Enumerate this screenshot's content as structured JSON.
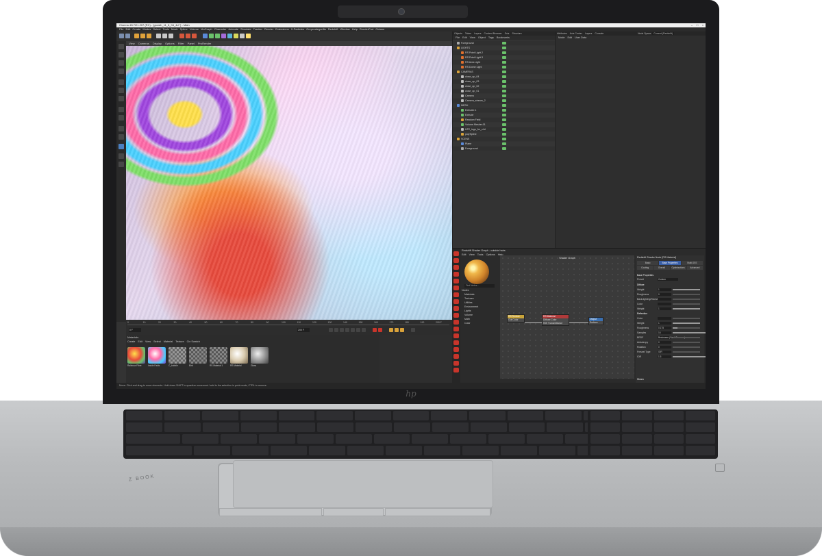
{
  "app": {
    "title": "Cinema 4D R21.207 (RC) - [growth_11_8_04_4d *] - Main",
    "node_space_label": "Node Space:",
    "node_space_value": "Current (Redshift)",
    "layout_label": "Layout:",
    "layout_value": "Startup (User)"
  },
  "menubar": [
    "File",
    "Edit",
    "Create",
    "Modes",
    "Select",
    "Tools",
    "Mesh",
    "Spline",
    "Volume",
    "MoGraph",
    "Character",
    "Animate",
    "Simulate",
    "Tracker",
    "Render",
    "Extensions",
    "X-Particles",
    "Greyscalegorilla",
    "Redshift",
    "Window",
    "Help",
    "RenderPort",
    "Octane"
  ],
  "viewport": {
    "menu": [
      "View",
      "Cameras",
      "Display",
      "Options",
      "Filter",
      "Panel",
      "ProRender"
    ],
    "timeline_ticks": [
      "0",
      "10",
      "20",
      "30",
      "40",
      "50",
      "60",
      "70",
      "80",
      "90",
      "100",
      "110",
      "120",
      "130",
      "140",
      "150",
      "160",
      "170",
      "180",
      "190",
      "200 F"
    ],
    "current_frame": "0 F",
    "end_frame": "200 F"
  },
  "materials": {
    "title": "Materials",
    "menu": [
      "Create",
      "Edit",
      "View",
      "Select",
      "Material",
      "Texture",
      "Cin Swatch"
    ],
    "items": [
      "Rainbow Fibre",
      "Inside Fadis",
      "C_bubble",
      "Bird",
      "RS Material 1",
      "RS Material",
      "Glass"
    ]
  },
  "object_manager": {
    "tabs": [
      "Objects",
      "Takes",
      "Layers",
      "Content Browser",
      "Scts",
      "Structure"
    ],
    "menu": [
      "File",
      "Edit",
      "View",
      "Object",
      "Tags",
      "Bookmarks"
    ],
    "rows": [
      {
        "name": "Foreground",
        "color": "#aaaaaa",
        "indent": 0
      },
      {
        "name": "LIGHTS",
        "color": "#d9a23a",
        "indent": 0
      },
      {
        "name": "RS Point Light.2",
        "color": "#e0702d",
        "indent": 1
      },
      {
        "name": "RS Point Light.3",
        "color": "#e0702d",
        "indent": 1
      },
      {
        "name": "RS Area Light",
        "color": "#e0702d",
        "indent": 1
      },
      {
        "name": "RS Dome Light",
        "color": "#e0702d",
        "indent": 1
      },
      {
        "name": "CAMERAS",
        "color": "#d9a23a",
        "indent": 0
      },
      {
        "name": "close_up_04",
        "color": "#bbbbbb",
        "indent": 1
      },
      {
        "name": "close_up_03",
        "color": "#bbbbbb",
        "indent": 1
      },
      {
        "name": "close_up_02",
        "color": "#bbbbbb",
        "indent": 1
      },
      {
        "name": "close_up_01",
        "color": "#bbbbbb",
        "indent": 1
      },
      {
        "name": "Camera",
        "color": "#bbbbbb",
        "indent": 1
      },
      {
        "name": "Camera_stream_2",
        "color": "#bbbbbb",
        "indent": 1
      },
      {
        "name": "MESH",
        "color": "#5a8ad9",
        "indent": 0
      },
      {
        "name": "Extruder.1",
        "color": "#6bc26b",
        "indent": 1
      },
      {
        "name": "Extrude",
        "color": "#6bc26b",
        "indent": 1
      },
      {
        "name": "Random Field",
        "color": "#d9a23a",
        "indent": 1
      },
      {
        "name": "Volume Mesher.01",
        "color": "#6bc26b",
        "indent": 1
      },
      {
        "name": "HP2_logo_for_c4d",
        "color": "#bbbbbb",
        "indent": 1
      },
      {
        "name": "polySpline",
        "color": "#d9a23a",
        "indent": 1
      },
      {
        "name": "SCENE",
        "color": "#d9a23a",
        "indent": 0
      },
      {
        "name": "Plane",
        "color": "#5a8ad9",
        "indent": 1
      },
      {
        "name": "Foreground",
        "color": "#aaaaaa",
        "indent": 1
      }
    ]
  },
  "attribute_manager": {
    "tabs": [
      "Attributes",
      "Axis Center",
      "Layers",
      "Console"
    ],
    "menu": [
      "Mode",
      "Edit",
      "User Data"
    ]
  },
  "shader_graph": {
    "title": "Redshift Shader Graph - outside hairs",
    "menu": [
      "Edit",
      "View",
      "Tools",
      "Options",
      "Help"
    ],
    "graph_title": "Shader Graph",
    "find_placeholder": "Find Nodes...",
    "categories": [
      "Nodes",
      "Materials",
      "Textures",
      "Utilities",
      "Environment",
      "Lights",
      "Volume",
      "Math",
      "Color"
    ],
    "nodes": {
      "rs_texture": {
        "title": "RS Texture",
        "ports": [
          "Out Color"
        ]
      },
      "rs_material": {
        "title": "RS Material",
        "ports": [
          "Diffuse Color",
          "Refl Transmittance",
          "Out Color"
        ]
      },
      "output": {
        "title": "Output",
        "ports": [
          "Surface"
        ]
      }
    },
    "properties": {
      "title": "Redshift Shader Node [RS Material]",
      "tabs": [
        "Basic",
        "Base Properties",
        "Multi-SSS",
        "Coating",
        "Overall",
        "Optimizations",
        "Advanced"
      ],
      "section_base": "Base Properties",
      "preset_label": "Preset",
      "preset_value": "Custom",
      "diffuse": "Diffuse",
      "rows": [
        {
          "label": "Weight",
          "value": "1"
        },
        {
          "label": "Roughness",
          "value": "0"
        },
        {
          "label": "Back-lighting/Translucency",
          "value": ""
        },
        {
          "label": "Color",
          "value": ""
        },
        {
          "label": "Weight",
          "value": "1"
        }
      ],
      "reflection": "Reflection",
      "refl_rows": [
        {
          "label": "Color",
          "value": ""
        },
        {
          "label": "Weight",
          "value": "1"
        },
        {
          "label": "Roughness",
          "value": "0.175"
        },
        {
          "label": "Samples",
          "value": "16"
        },
        {
          "label": "BRDF",
          "value": "Beckmann (Cook-Torrance)"
        },
        {
          "label": "Anisotropy",
          "value": "0"
        },
        {
          "label": "Rotation",
          "value": "0"
        },
        {
          "label": "Fresnel Type",
          "value": "IOR"
        },
        {
          "label": "IOR",
          "value": "1.5"
        }
      ],
      "sheen": "Sheen"
    }
  },
  "status": {
    "text": "Move: Click and drag to move elements. Hold down SHIFT to quantize movement / add to the selection in point mode, CTRL to remove."
  },
  "hardware": {
    "logo": "hp",
    "brand": "Z BOOK"
  }
}
